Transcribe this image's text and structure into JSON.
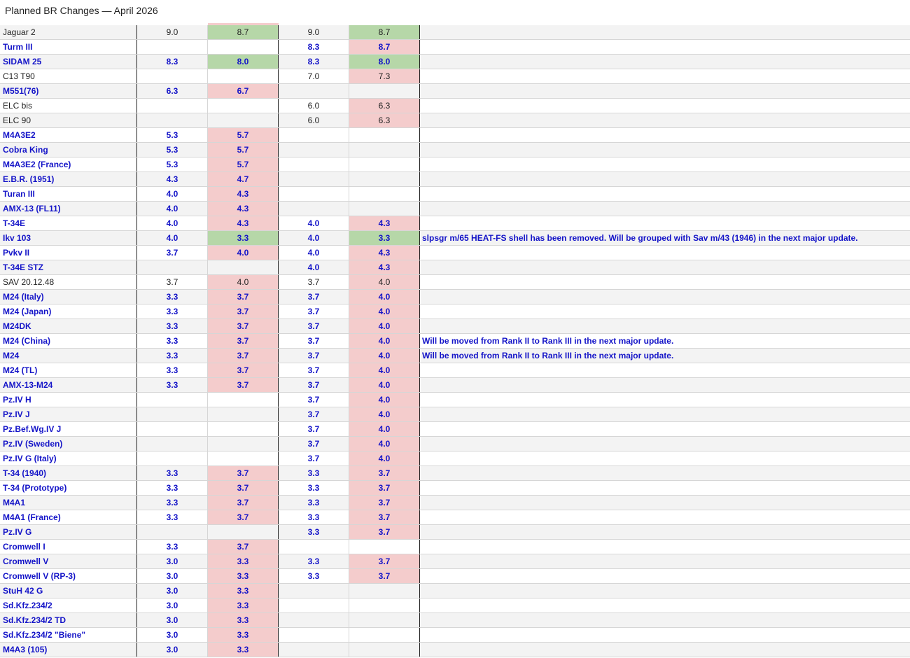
{
  "title": "Planned BR Changes — April 2026",
  "colors": {
    "increase": "#f4cccc",
    "decrease": "#b6d7a8",
    "highlight_text": "#1414c8",
    "normal_text": "#222222"
  },
  "columns": [
    "vehicle",
    "ab_current",
    "ab_planned",
    "rb_current",
    "rb_planned",
    "note"
  ],
  "rows": [
    {
      "name": "Jaguar 2",
      "style": "normal",
      "ab_old": "9.0",
      "ab_new": "8.7",
      "ab_dir": "down",
      "rb_old": "9.0",
      "rb_new": "8.7",
      "rb_dir": "down",
      "note": ""
    },
    {
      "name": "Turm III",
      "style": "blue",
      "ab_old": "",
      "ab_new": "",
      "ab_dir": "",
      "rb_old": "8.3",
      "rb_new": "8.7",
      "rb_dir": "up",
      "note": ""
    },
    {
      "name": "SIDAM 25",
      "style": "blue",
      "ab_old": "8.3",
      "ab_new": "8.0",
      "ab_dir": "down",
      "rb_old": "8.3",
      "rb_new": "8.0",
      "rb_dir": "down",
      "note": ""
    },
    {
      "name": "C13 T90",
      "style": "normal",
      "ab_old": "",
      "ab_new": "",
      "ab_dir": "",
      "rb_old": "7.0",
      "rb_new": "7.3",
      "rb_dir": "up",
      "note": ""
    },
    {
      "name": "M551(76)",
      "style": "blue",
      "ab_old": "6.3",
      "ab_new": "6.7",
      "ab_dir": "up",
      "rb_old": "",
      "rb_new": "",
      "rb_dir": "",
      "note": ""
    },
    {
      "name": "ELC bis",
      "style": "normal",
      "ab_old": "",
      "ab_new": "",
      "ab_dir": "",
      "rb_old": "6.0",
      "rb_new": "6.3",
      "rb_dir": "up",
      "note": ""
    },
    {
      "name": "ELC 90",
      "style": "normal",
      "ab_old": "",
      "ab_new": "",
      "ab_dir": "",
      "rb_old": "6.0",
      "rb_new": "6.3",
      "rb_dir": "up",
      "note": ""
    },
    {
      "name": "M4A3E2",
      "style": "blue",
      "ab_old": "5.3",
      "ab_new": "5.7",
      "ab_dir": "up",
      "rb_old": "",
      "rb_new": "",
      "rb_dir": "",
      "note": ""
    },
    {
      "name": "Cobra King",
      "style": "blue",
      "ab_old": "5.3",
      "ab_new": "5.7",
      "ab_dir": "up",
      "rb_old": "",
      "rb_new": "",
      "rb_dir": "",
      "note": ""
    },
    {
      "name": "M4A3E2 (France)",
      "style": "blue",
      "ab_old": "5.3",
      "ab_new": "5.7",
      "ab_dir": "up",
      "rb_old": "",
      "rb_new": "",
      "rb_dir": "",
      "note": ""
    },
    {
      "name": "E.B.R. (1951)",
      "style": "blue",
      "ab_old": "4.3",
      "ab_new": "4.7",
      "ab_dir": "up",
      "rb_old": "",
      "rb_new": "",
      "rb_dir": "",
      "note": ""
    },
    {
      "name": "Turan III",
      "style": "blue",
      "ab_old": "4.0",
      "ab_new": "4.3",
      "ab_dir": "up",
      "rb_old": "",
      "rb_new": "",
      "rb_dir": "",
      "note": ""
    },
    {
      "name": "AMX-13 (FL11)",
      "style": "blue",
      "ab_old": "4.0",
      "ab_new": "4.3",
      "ab_dir": "up",
      "rb_old": "",
      "rb_new": "",
      "rb_dir": "",
      "note": ""
    },
    {
      "name": "T-34E",
      "style": "blue",
      "ab_old": "4.0",
      "ab_new": "4.3",
      "ab_dir": "up",
      "rb_old": "4.0",
      "rb_new": "4.3",
      "rb_dir": "up",
      "note": ""
    },
    {
      "name": "Ikv 103",
      "style": "blue",
      "ab_old": "4.0",
      "ab_new": "3.3",
      "ab_dir": "down",
      "rb_old": "4.0",
      "rb_new": "3.3",
      "rb_dir": "down",
      "note": "slpsgr m/65 HEAT-FS shell has been removed. Will be grouped with Sav m/43 (1946) in the next major update."
    },
    {
      "name": "Pvkv II",
      "style": "blue",
      "ab_old": "3.7",
      "ab_new": "4.0",
      "ab_dir": "up",
      "rb_old": "4.0",
      "rb_new": "4.3",
      "rb_dir": "up",
      "note": ""
    },
    {
      "name": "T-34E STZ",
      "style": "blue",
      "ab_old": "",
      "ab_new": "",
      "ab_dir": "",
      "rb_old": "4.0",
      "rb_new": "4.3",
      "rb_dir": "up",
      "note": ""
    },
    {
      "name": "SAV 20.12.48",
      "style": "normal",
      "ab_old": "3.7",
      "ab_new": "4.0",
      "ab_dir": "up",
      "rb_old": "3.7",
      "rb_new": "4.0",
      "rb_dir": "up",
      "note": ""
    },
    {
      "name": "M24 (Italy)",
      "style": "blue",
      "ab_old": "3.3",
      "ab_new": "3.7",
      "ab_dir": "up",
      "rb_old": "3.7",
      "rb_new": "4.0",
      "rb_dir": "up",
      "note": ""
    },
    {
      "name": "M24 (Japan)",
      "style": "blue",
      "ab_old": "3.3",
      "ab_new": "3.7",
      "ab_dir": "up",
      "rb_old": "3.7",
      "rb_new": "4.0",
      "rb_dir": "up",
      "note": ""
    },
    {
      "name": "M24DK",
      "style": "blue",
      "ab_old": "3.3",
      "ab_new": "3.7",
      "ab_dir": "up",
      "rb_old": "3.7",
      "rb_new": "4.0",
      "rb_dir": "up",
      "note": ""
    },
    {
      "name": "M24 (China)",
      "style": "blue",
      "ab_old": "3.3",
      "ab_new": "3.7",
      "ab_dir": "up",
      "rb_old": "3.7",
      "rb_new": "4.0",
      "rb_dir": "up",
      "note": "Will be moved from Rank II to Rank III in the next major update."
    },
    {
      "name": "M24",
      "style": "blue",
      "ab_old": "3.3",
      "ab_new": "3.7",
      "ab_dir": "up",
      "rb_old": "3.7",
      "rb_new": "4.0",
      "rb_dir": "up",
      "note": "Will be moved from Rank II to Rank III in the next major update."
    },
    {
      "name": "M24 (TL)",
      "style": "blue",
      "ab_old": "3.3",
      "ab_new": "3.7",
      "ab_dir": "up",
      "rb_old": "3.7",
      "rb_new": "4.0",
      "rb_dir": "up",
      "note": ""
    },
    {
      "name": "AMX-13-M24",
      "style": "blue",
      "ab_old": "3.3",
      "ab_new": "3.7",
      "ab_dir": "up",
      "rb_old": "3.7",
      "rb_new": "4.0",
      "rb_dir": "up",
      "note": ""
    },
    {
      "name": "Pz.IV H",
      "style": "blue",
      "ab_old": "",
      "ab_new": "",
      "ab_dir": "",
      "rb_old": "3.7",
      "rb_new": "4.0",
      "rb_dir": "up",
      "note": ""
    },
    {
      "name": "Pz.IV J",
      "style": "blue",
      "ab_old": "",
      "ab_new": "",
      "ab_dir": "",
      "rb_old": "3.7",
      "rb_new": "4.0",
      "rb_dir": "up",
      "note": ""
    },
    {
      "name": "Pz.Bef.Wg.IV J",
      "style": "blue",
      "ab_old": "",
      "ab_new": "",
      "ab_dir": "",
      "rb_old": "3.7",
      "rb_new": "4.0",
      "rb_dir": "up",
      "note": ""
    },
    {
      "name": "Pz.IV (Sweden)",
      "style": "blue",
      "ab_old": "",
      "ab_new": "",
      "ab_dir": "",
      "rb_old": "3.7",
      "rb_new": "4.0",
      "rb_dir": "up",
      "note": ""
    },
    {
      "name": "Pz.IV G (Italy)",
      "style": "blue",
      "ab_old": "",
      "ab_new": "",
      "ab_dir": "",
      "rb_old": "3.7",
      "rb_new": "4.0",
      "rb_dir": "up",
      "note": ""
    },
    {
      "name": "T-34 (1940)",
      "style": "blue",
      "ab_old": "3.3",
      "ab_new": "3.7",
      "ab_dir": "up",
      "rb_old": "3.3",
      "rb_new": "3.7",
      "rb_dir": "up",
      "note": ""
    },
    {
      "name": "T-34 (Prototype)",
      "style": "blue",
      "ab_old": "3.3",
      "ab_new": "3.7",
      "ab_dir": "up",
      "rb_old": "3.3",
      "rb_new": "3.7",
      "rb_dir": "up",
      "note": ""
    },
    {
      "name": "M4A1",
      "style": "blue",
      "ab_old": "3.3",
      "ab_new": "3.7",
      "ab_dir": "up",
      "rb_old": "3.3",
      "rb_new": "3.7",
      "rb_dir": "up",
      "note": ""
    },
    {
      "name": "M4A1 (France)",
      "style": "blue",
      "ab_old": "3.3",
      "ab_new": "3.7",
      "ab_dir": "up",
      "rb_old": "3.3",
      "rb_new": "3.7",
      "rb_dir": "up",
      "note": ""
    },
    {
      "name": "Pz.IV G",
      "style": "blue",
      "ab_old": "",
      "ab_new": "",
      "ab_dir": "",
      "rb_old": "3.3",
      "rb_new": "3.7",
      "rb_dir": "up",
      "note": ""
    },
    {
      "name": "Cromwell I",
      "style": "blue",
      "ab_old": "3.3",
      "ab_new": "3.7",
      "ab_dir": "up",
      "rb_old": "",
      "rb_new": "",
      "rb_dir": "",
      "note": ""
    },
    {
      "name": "Cromwell V",
      "style": "blue",
      "ab_old": "3.0",
      "ab_new": "3.3",
      "ab_dir": "up",
      "rb_old": "3.3",
      "rb_new": "3.7",
      "rb_dir": "up",
      "note": ""
    },
    {
      "name": "Cromwell V (RP-3)",
      "style": "blue",
      "ab_old": "3.0",
      "ab_new": "3.3",
      "ab_dir": "up",
      "rb_old": "3.3",
      "rb_new": "3.7",
      "rb_dir": "up",
      "note": ""
    },
    {
      "name": "StuH 42 G",
      "style": "blue",
      "ab_old": "3.0",
      "ab_new": "3.3",
      "ab_dir": "up",
      "rb_old": "",
      "rb_new": "",
      "rb_dir": "",
      "note": ""
    },
    {
      "name": "Sd.Kfz.234/2",
      "style": "blue",
      "ab_old": "3.0",
      "ab_new": "3.3",
      "ab_dir": "up",
      "rb_old": "",
      "rb_new": "",
      "rb_dir": "",
      "note": ""
    },
    {
      "name": "Sd.Kfz.234/2 TD",
      "style": "blue",
      "ab_old": "3.0",
      "ab_new": "3.3",
      "ab_dir": "up",
      "rb_old": "",
      "rb_new": "",
      "rb_dir": "",
      "note": ""
    },
    {
      "name": "Sd.Kfz.234/2 \"Biene\"",
      "style": "blue",
      "ab_old": "3.0",
      "ab_new": "3.3",
      "ab_dir": "up",
      "rb_old": "",
      "rb_new": "",
      "rb_dir": "",
      "note": ""
    },
    {
      "name": "M4A3 (105)",
      "style": "blue",
      "ab_old": "3.0",
      "ab_new": "3.3",
      "ab_dir": "up",
      "rb_old": "",
      "rb_new": "",
      "rb_dir": "",
      "note": ""
    }
  ]
}
